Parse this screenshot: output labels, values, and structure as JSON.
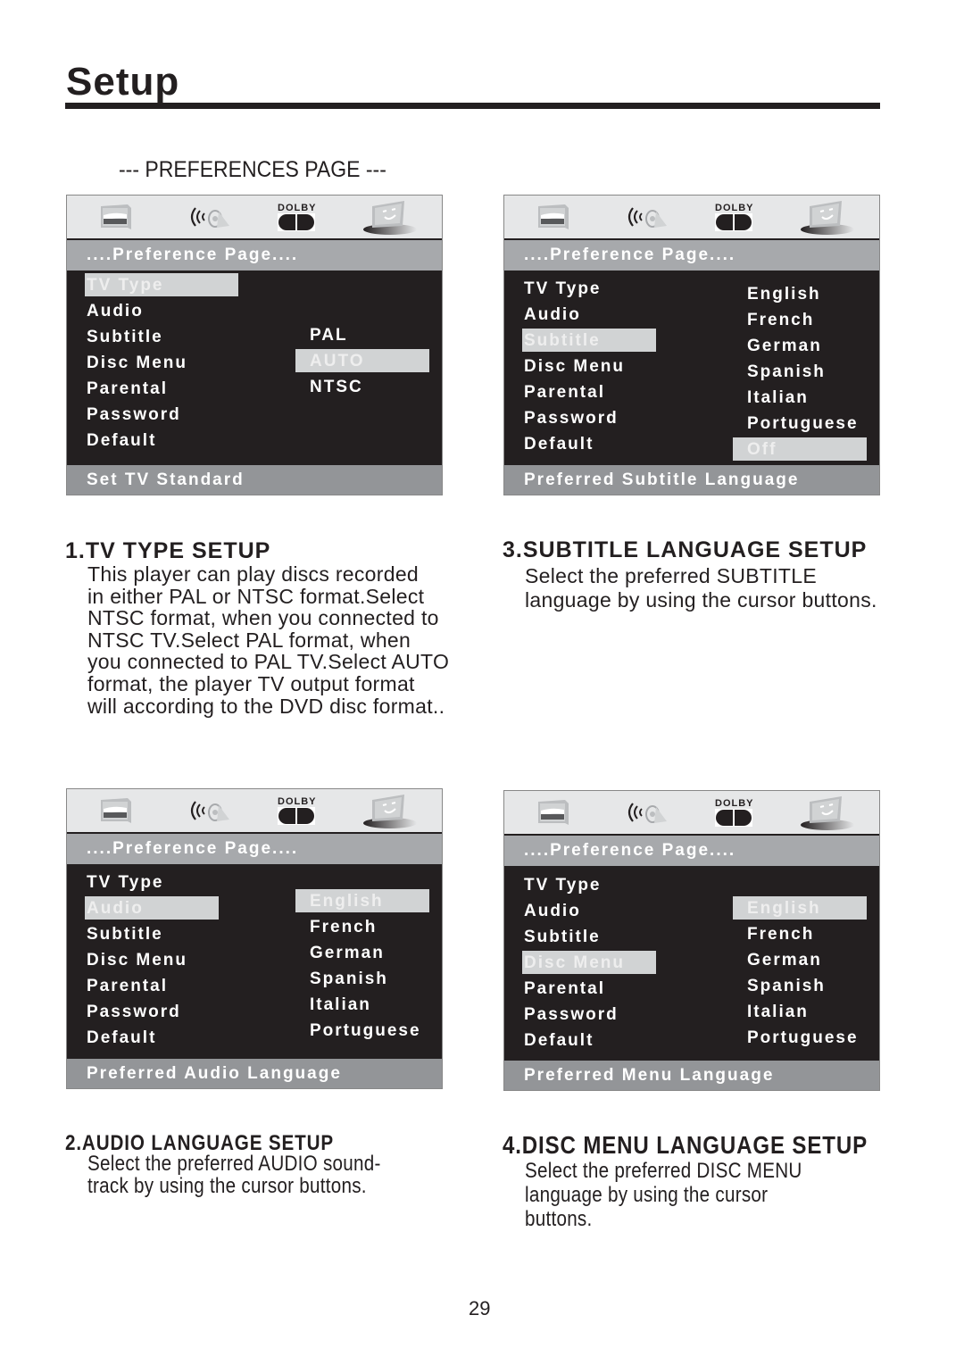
{
  "page": {
    "title": "Setup",
    "section_heading": "--- PREFERENCES PAGE ---",
    "page_number": "29"
  },
  "osd_common": {
    "icons": [
      "tv-setup-icon",
      "audio-speaker-icon",
      "dolby-icon",
      "preferences-monitor-icon"
    ],
    "dolby_label": "DOLBY",
    "title": "....Preference Page....",
    "menu_items": [
      "TV Type",
      "Audio",
      "Subtitle",
      "Disc Menu",
      "Parental",
      "Password",
      "Default"
    ]
  },
  "panels": [
    {
      "id": "tv-type",
      "selected_menu": "TV Type",
      "options": [
        "PAL",
        "AUTO",
        "NTSC"
      ],
      "selected_option": "AUTO",
      "status": "Set TV Standard"
    },
    {
      "id": "subtitle",
      "selected_menu": "Subtitle",
      "options": [
        "English",
        "French",
        "German",
        "Spanish",
        "Italian",
        "Portuguese",
        "Off"
      ],
      "selected_option": "Off",
      "status": "Preferred Subtitle Language"
    },
    {
      "id": "audio",
      "selected_menu": "Audio",
      "options": [
        "English",
        "French",
        "German",
        "Spanish",
        "Italian",
        "Portuguese"
      ],
      "selected_option": "English",
      "status": "Preferred Audio Language"
    },
    {
      "id": "disc-menu",
      "selected_menu": "Disc Menu",
      "options": [
        "English",
        "French",
        "German",
        "Spanish",
        "Italian",
        "Portuguese"
      ],
      "selected_option": "English",
      "status": "Preferred Menu Language"
    }
  ],
  "sections": [
    {
      "heading": "1.TV TYPE SETUP",
      "body": "This player can play discs recorded\nin either PAL or NTSC format.Select\nNTSC format, when you connected to\nNTSC TV.Select PAL format, when\nyou connected to PAL TV.Select AUTO\nformat, the player TV output format\nwill according to the DVD disc format.."
    },
    {
      "heading": "3.SUBTITLE LANGUAGE SETUP",
      "body": "Select the preferred SUBTITLE\nlanguage by using the cursor buttons."
    },
    {
      "heading": "2.AUDIO LANGUAGE SETUP",
      "body": "Select the preferred AUDIO sound-\ntrack by using the cursor buttons."
    },
    {
      "heading": "4.DISC MENU LANGUAGE SETUP",
      "body": "Select the preferred DISC MENU\nlanguage by using the cursor\nbuttons."
    }
  ]
}
